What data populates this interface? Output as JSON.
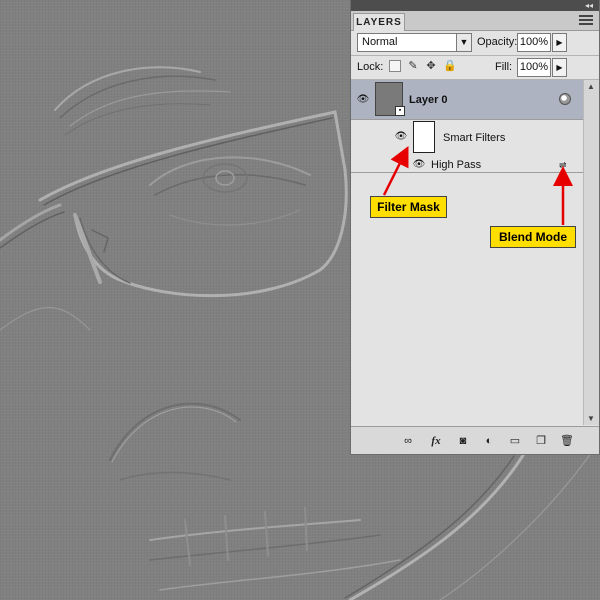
{
  "panel": {
    "tab_label": "LAYERS",
    "collapse_glyph": "◂◂",
    "menu_icon": "panel-menu-icon"
  },
  "options": {
    "blend_mode": "Normal",
    "opacity_label": "Opacity:",
    "opacity_value": "100%",
    "lock_label": "Lock:",
    "fill_label": "Fill:",
    "fill_value": "100%"
  },
  "layers": {
    "layer0_name": "Layer 0",
    "smart_filters_label": "Smart Filters",
    "filter_name": "High Pass"
  },
  "bottom_icons": [
    "link-icon",
    "fx-icon",
    "mask-icon",
    "adjustment-icon",
    "group-folder-icon",
    "new-layer-icon",
    "trash-icon"
  ],
  "annotations": {
    "filter_mask": "Filter Mask",
    "blend_mode": "Blend Mode"
  },
  "colors": {
    "canvas_gray": "#808080",
    "panel_bg": "#e3e3e3",
    "selected_layer": "#aeb3c2",
    "callout_yellow": "#ffde00",
    "arrow_red": "#e60000"
  }
}
